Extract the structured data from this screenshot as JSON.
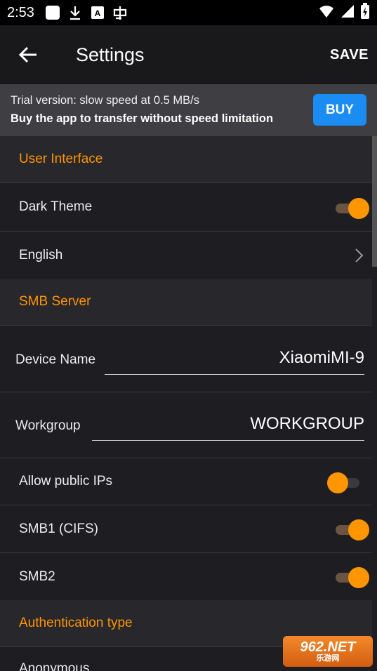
{
  "status_bar": {
    "time": "2:53",
    "left_icons": [
      "app-square-icon",
      "download-icon",
      "a-box-icon",
      "chinese-char-icon"
    ],
    "right_icons": [
      "wifi-icon",
      "signal-icon",
      "battery-charging-icon"
    ]
  },
  "app_bar": {
    "title": "Settings",
    "save_label": "SAVE"
  },
  "trial_banner": {
    "line1": "Trial version: slow speed at 0.5 MB/s",
    "line2": "Buy the app to transfer without speed limitation",
    "buy_label": "BUY",
    "buy_color": "#1a8cf2"
  },
  "sections": {
    "user_interface": "User Interface",
    "smb_server": "SMB Server",
    "auth_type": "Authentication type"
  },
  "settings": {
    "dark_theme": {
      "label": "Dark Theme",
      "on": true
    },
    "language": {
      "label": "English"
    },
    "device_name": {
      "label": "Device Name",
      "value": "XiaomiMI-9"
    },
    "workgroup": {
      "label": "Workgroup",
      "value": "WORKGROUP"
    },
    "allow_public_ips": {
      "label": "Allow public IPs",
      "on": false
    },
    "smb1": {
      "label": "SMB1 (CIFS)",
      "on": true
    },
    "smb2": {
      "label": "SMB2",
      "on": true
    },
    "auth_first_option": {
      "label": "Anonymous"
    }
  },
  "accent_color": "#ff9400",
  "watermark": {
    "line1": "962.NET",
    "line2": "乐游网"
  }
}
